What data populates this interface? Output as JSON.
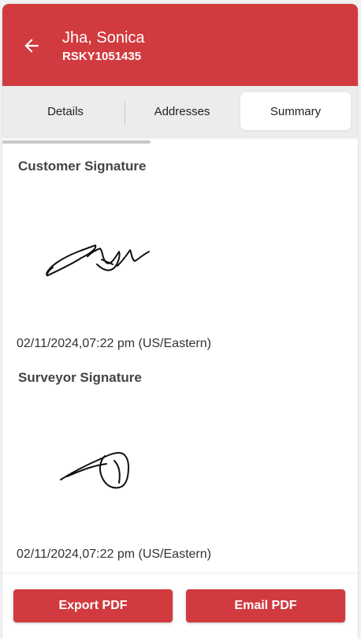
{
  "header": {
    "title": "Jha, Sonica",
    "subtitle": "RSKY1051435",
    "back_icon": "arrow-left-icon",
    "background_color": "#d13b3f"
  },
  "tabs": [
    {
      "label": "Details",
      "active": false
    },
    {
      "label": "Addresses",
      "active": false
    },
    {
      "label": "Summary",
      "active": true
    }
  ],
  "customer_signature": {
    "heading": "Customer Signature",
    "timestamp": "02/11/2024,07:22 pm (US/Eastern)"
  },
  "surveyor_signature": {
    "heading": "Surveyor Signature",
    "timestamp": "02/11/2024,07:22 pm (US/Eastern)"
  },
  "footer": {
    "export_label": "Export PDF",
    "email_label": "Email PDF",
    "button_color": "#d13b3f"
  }
}
